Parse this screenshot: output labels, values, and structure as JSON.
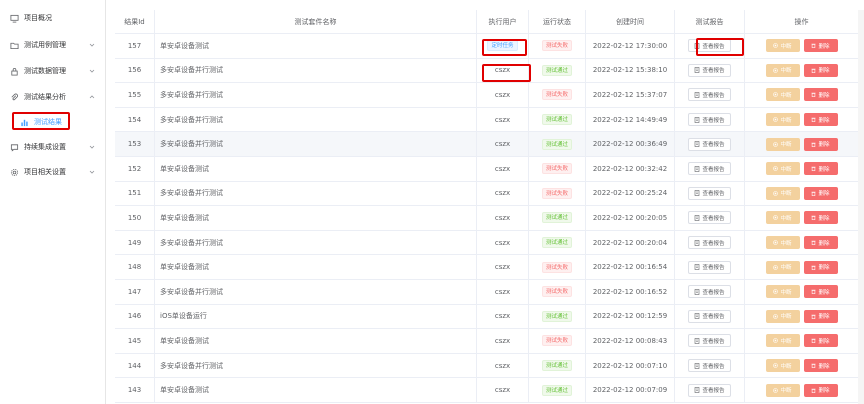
{
  "sidebar": {
    "items": [
      {
        "label": "项目概况",
        "icon": "monitor-icon"
      },
      {
        "label": "测试用例管理",
        "icon": "folder-icon",
        "expandable": true
      },
      {
        "label": "测试数据管理",
        "icon": "lock-icon",
        "expandable": true
      },
      {
        "label": "测试结果分析",
        "icon": "paperclip-icon",
        "expandable": true
      },
      {
        "label": "测试结果",
        "icon": "bar-chart-icon",
        "active": true
      },
      {
        "label": "持续集成设置",
        "icon": "chat-icon",
        "expandable": true
      },
      {
        "label": "项目相关设置",
        "icon": "gear-icon",
        "expandable": true
      }
    ]
  },
  "table": {
    "headers": {
      "id": "结果Id",
      "name": "测试套件名称",
      "user": "执行用户",
      "status": "运行状态",
      "time": "创建时间",
      "report": "测试报告",
      "actions": "操作"
    },
    "report_label": "查看报告",
    "stop_label": "中断",
    "delete_label": "删除",
    "rows": [
      {
        "id": "157",
        "name": "单安卓设备测试",
        "user": "定时任务",
        "status": "测试失败",
        "status_type": "fail",
        "time": "2022-02-12 17:30:00"
      },
      {
        "id": "156",
        "name": "多安卓设备并行测试",
        "user": "cszx",
        "status": "测试通过",
        "status_type": "pass",
        "time": "2022-02-12 15:38:10"
      },
      {
        "id": "155",
        "name": "多安卓设备并行测试",
        "user": "cszx",
        "status": "测试失败",
        "status_type": "fail",
        "time": "2022-02-12 15:37:07"
      },
      {
        "id": "154",
        "name": "多安卓设备并行测试",
        "user": "cszx",
        "status": "测试通过",
        "status_type": "pass",
        "time": "2022-02-12 14:49:49"
      },
      {
        "id": "153",
        "name": "多安卓设备并行测试",
        "user": "cszx",
        "status": "测试通过",
        "status_type": "pass",
        "time": "2022-02-12 00:36:49"
      },
      {
        "id": "152",
        "name": "单安卓设备测试",
        "user": "cszx",
        "status": "测试失败",
        "status_type": "fail",
        "time": "2022-02-12 00:32:42"
      },
      {
        "id": "151",
        "name": "多安卓设备并行测试",
        "user": "cszx",
        "status": "测试失败",
        "status_type": "fail",
        "time": "2022-02-12 00:25:24"
      },
      {
        "id": "150",
        "name": "单安卓设备测试",
        "user": "cszx",
        "status": "测试通过",
        "status_type": "pass",
        "time": "2022-02-12 00:20:05"
      },
      {
        "id": "149",
        "name": "多安卓设备并行测试",
        "user": "cszx",
        "status": "测试通过",
        "status_type": "pass",
        "time": "2022-02-12 00:20:04"
      },
      {
        "id": "148",
        "name": "单安卓设备测试",
        "user": "cszx",
        "status": "测试失败",
        "status_type": "fail",
        "time": "2022-02-12 00:16:54"
      },
      {
        "id": "147",
        "name": "多安卓设备并行测试",
        "user": "cszx",
        "status": "测试失败",
        "status_type": "fail",
        "time": "2022-02-12 00:16:52"
      },
      {
        "id": "146",
        "name": "iOS单设备运行",
        "user": "cszx",
        "status": "测试通过",
        "status_type": "pass",
        "time": "2022-02-12 00:12:59"
      },
      {
        "id": "145",
        "name": "单安卓设备测试",
        "user": "cszx",
        "status": "测试失败",
        "status_type": "fail",
        "time": "2022-02-12 00:08:43"
      },
      {
        "id": "144",
        "name": "多安卓设备并行测试",
        "user": "cszx",
        "status": "测试通过",
        "status_type": "pass",
        "time": "2022-02-12 00:07:10"
      },
      {
        "id": "143",
        "name": "单安卓设备测试",
        "user": "cszx",
        "status": "测试通过",
        "status_type": "pass",
        "time": "2022-02-12 00:07:09"
      }
    ]
  },
  "colors": {
    "primary": "#409eff",
    "danger": "#f56c6c",
    "success": "#67c23a",
    "warning_light": "#f3d19e",
    "highlight_box": "#e00000"
  }
}
